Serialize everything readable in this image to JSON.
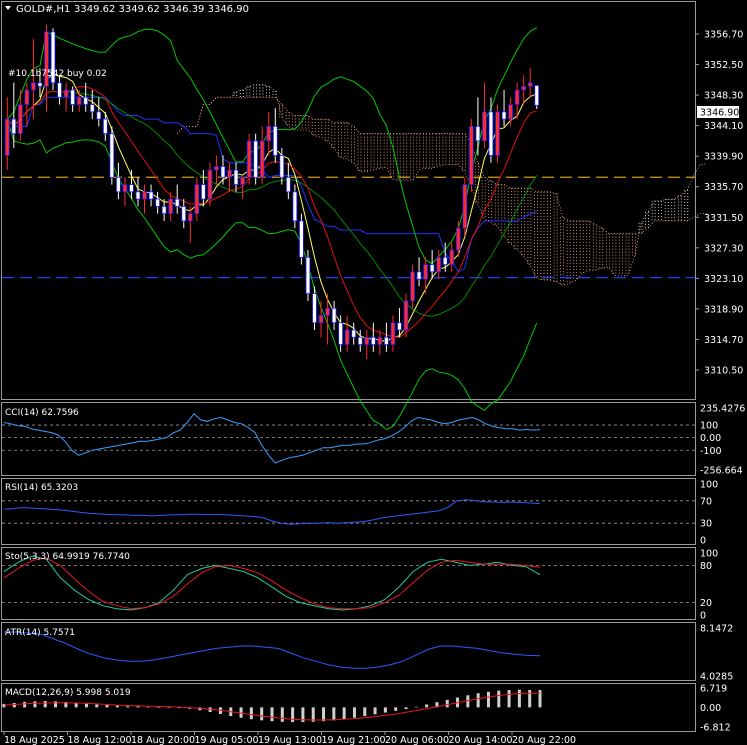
{
  "window": {
    "symbol_label": "GOLD#,H1",
    "ohlc_label": "3349.62 3349.62 3346.39 3346.90",
    "ichimoku_label": "#10.1b7542 buy 0.02",
    "current_price_label": "3346.90"
  },
  "colors": {
    "background": "#000000",
    "bull_body": "#ff2a2a",
    "bear_body": "#ffffff",
    "candle_outline": "#1c1cff",
    "bollinger": "#00c800",
    "ma_fast": "#ffff60",
    "ma_slow": "#e01010",
    "ichimoku_cloud": "#ffffff",
    "ichimoku_cloud_bear": "#ffb090",
    "kijun": "#1e32ff",
    "hline_orange": "#d49a10",
    "hline_blue": "#2040ff",
    "cci_line": "#3aa0ff",
    "rsi_line": "#2a5cff",
    "stoch_main": "#22c8a0",
    "stoch_signal": "#e81818",
    "atr_line": "#2a5cff",
    "macd_hist": "#d0d0d0",
    "macd_signal": "#e81818"
  },
  "chart_data": {
    "type": "candlestick",
    "symbol": "GOLD#",
    "timeframe": "H1",
    "price_axis": {
      "min": 3310.5,
      "max": 3356.7,
      "ticks": [
        "3356.70",
        "3352.50",
        "3348.30",
        "3344.10",
        "3339.90",
        "3335.70",
        "3331.50",
        "3327.30",
        "3323.10",
        "3318.90",
        "3314.70",
        "3310.50"
      ]
    },
    "x_axis_labels": [
      "18 Aug 2025",
      "18 Aug 12:00",
      "18 Aug 20:00",
      "19 Aug 05:00",
      "19 Aug 13:00",
      "19 Aug 21:00",
      "20 Aug 06:00",
      "20 Aug 14:00",
      "20 Aug 22:00"
    ],
    "horizontal_levels": [
      {
        "price": 3337.0,
        "style": "dashed",
        "color": "orange"
      },
      {
        "price": 3323.2,
        "style": "dashed",
        "color": "blue"
      }
    ],
    "candles": [
      {
        "o": 3340,
        "h": 3348,
        "l": 3338,
        "c": 3345
      },
      {
        "o": 3345,
        "h": 3350,
        "l": 3341,
        "c": 3343
      },
      {
        "o": 3343,
        "h": 3349,
        "l": 3342,
        "c": 3347
      },
      {
        "o": 3347,
        "h": 3350,
        "l": 3344,
        "c": 3349
      },
      {
        "o": 3349,
        "h": 3356,
        "l": 3345,
        "c": 3350
      },
      {
        "o": 3350,
        "h": 3352,
        "l": 3348,
        "c": 3349.5
      },
      {
        "o": 3349.5,
        "h": 3358,
        "l": 3346,
        "c": 3357
      },
      {
        "o": 3357,
        "h": 3357.5,
        "l": 3349,
        "c": 3350
      },
      {
        "o": 3350,
        "h": 3351,
        "l": 3347,
        "c": 3348
      },
      {
        "o": 3348,
        "h": 3350,
        "l": 3346,
        "c": 3349
      },
      {
        "o": 3349,
        "h": 3349.5,
        "l": 3346,
        "c": 3347
      },
      {
        "o": 3347,
        "h": 3349,
        "l": 3346,
        "c": 3348
      },
      {
        "o": 3348,
        "h": 3350,
        "l": 3346,
        "c": 3347
      },
      {
        "o": 3347,
        "h": 3349,
        "l": 3345,
        "c": 3346
      },
      {
        "o": 3346,
        "h": 3348,
        "l": 3344,
        "c": 3345
      },
      {
        "o": 3345,
        "h": 3346,
        "l": 3342,
        "c": 3343
      },
      {
        "o": 3343,
        "h": 3344,
        "l": 3336,
        "c": 3337
      },
      {
        "o": 3337,
        "h": 3339,
        "l": 3334,
        "c": 3335
      },
      {
        "o": 3335,
        "h": 3337,
        "l": 3333,
        "c": 3336
      },
      {
        "o": 3336,
        "h": 3338,
        "l": 3334,
        "c": 3335
      },
      {
        "o": 3335,
        "h": 3337,
        "l": 3333,
        "c": 3334
      },
      {
        "o": 3334,
        "h": 3336,
        "l": 3332,
        "c": 3335
      },
      {
        "o": 3335,
        "h": 3336,
        "l": 3333,
        "c": 3334
      },
      {
        "o": 3334,
        "h": 3335,
        "l": 3332,
        "c": 3333
      },
      {
        "o": 3333,
        "h": 3334,
        "l": 3331,
        "c": 3332
      },
      {
        "o": 3332,
        "h": 3335,
        "l": 3331,
        "c": 3334
      },
      {
        "o": 3334,
        "h": 3336,
        "l": 3332,
        "c": 3333
      },
      {
        "o": 3333,
        "h": 3334,
        "l": 3330,
        "c": 3331
      },
      {
        "o": 3331,
        "h": 3333,
        "l": 3328,
        "c": 3332
      },
      {
        "o": 3332,
        "h": 3337,
        "l": 3331,
        "c": 3336
      },
      {
        "o": 3336,
        "h": 3338,
        "l": 3333,
        "c": 3334
      },
      {
        "o": 3334,
        "h": 3339,
        "l": 3333,
        "c": 3338
      },
      {
        "o": 3338,
        "h": 3340,
        "l": 3336,
        "c": 3338.5
      },
      {
        "o": 3338.5,
        "h": 3340,
        "l": 3336,
        "c": 3337
      },
      {
        "o": 3337,
        "h": 3339,
        "l": 3335,
        "c": 3338
      },
      {
        "o": 3338,
        "h": 3339,
        "l": 3335,
        "c": 3336
      },
      {
        "o": 3336,
        "h": 3337,
        "l": 3334,
        "c": 3337
      },
      {
        "o": 3337,
        "h": 3343,
        "l": 3336,
        "c": 3342
      },
      {
        "o": 3342,
        "h": 3343,
        "l": 3336,
        "c": 3337
      },
      {
        "o": 3337,
        "h": 3344,
        "l": 3336,
        "c": 3342
      },
      {
        "o": 3342,
        "h": 3346,
        "l": 3340,
        "c": 3344
      },
      {
        "o": 3344,
        "h": 3346.5,
        "l": 3339,
        "c": 3340
      },
      {
        "o": 3340,
        "h": 3341,
        "l": 3336,
        "c": 3337
      },
      {
        "o": 3337,
        "h": 3339,
        "l": 3334,
        "c": 3335
      },
      {
        "o": 3335,
        "h": 3336,
        "l": 3330,
        "c": 3331
      },
      {
        "o": 3331,
        "h": 3332,
        "l": 3325,
        "c": 3326
      },
      {
        "o": 3326,
        "h": 3327,
        "l": 3320,
        "c": 3321
      },
      {
        "o": 3321,
        "h": 3322,
        "l": 3316,
        "c": 3317
      },
      {
        "o": 3317,
        "h": 3320,
        "l": 3315,
        "c": 3318
      },
      {
        "o": 3318,
        "h": 3321,
        "l": 3314,
        "c": 3319
      },
      {
        "o": 3319,
        "h": 3320,
        "l": 3316,
        "c": 3317
      },
      {
        "o": 3317,
        "h": 3318,
        "l": 3313,
        "c": 3314
      },
      {
        "o": 3314,
        "h": 3318,
        "l": 3313,
        "c": 3316
      },
      {
        "o": 3316,
        "h": 3317,
        "l": 3314,
        "c": 3315
      },
      {
        "o": 3315,
        "h": 3316,
        "l": 3313,
        "c": 3314
      },
      {
        "o": 3314,
        "h": 3316,
        "l": 3312,
        "c": 3315
      },
      {
        "o": 3315,
        "h": 3317,
        "l": 3313,
        "c": 3314
      },
      {
        "o": 3314,
        "h": 3316,
        "l": 3312.5,
        "c": 3315
      },
      {
        "o": 3315,
        "h": 3317,
        "l": 3313,
        "c": 3314
      },
      {
        "o": 3314,
        "h": 3318,
        "l": 3313,
        "c": 3317
      },
      {
        "o": 3317,
        "h": 3319,
        "l": 3315,
        "c": 3316
      },
      {
        "o": 3316,
        "h": 3321,
        "l": 3315,
        "c": 3320
      },
      {
        "o": 3320,
        "h": 3325,
        "l": 3319,
        "c": 3324
      },
      {
        "o": 3324,
        "h": 3326,
        "l": 3322,
        "c": 3323
      },
      {
        "o": 3323,
        "h": 3326,
        "l": 3321,
        "c": 3325
      },
      {
        "o": 3325,
        "h": 3327,
        "l": 3323,
        "c": 3324
      },
      {
        "o": 3324,
        "h": 3327,
        "l": 3323,
        "c": 3326
      },
      {
        "o": 3326,
        "h": 3328,
        "l": 3324,
        "c": 3325
      },
      {
        "o": 3325,
        "h": 3328,
        "l": 3324,
        "c": 3327
      },
      {
        "o": 3327,
        "h": 3331,
        "l": 3326,
        "c": 3330
      },
      {
        "o": 3330,
        "h": 3337,
        "l": 3329,
        "c": 3336
      },
      {
        "o": 3336,
        "h": 3345,
        "l": 3335,
        "c": 3344
      },
      {
        "o": 3344,
        "h": 3348,
        "l": 3340,
        "c": 3342
      },
      {
        "o": 3342,
        "h": 3350,
        "l": 3341,
        "c": 3346
      },
      {
        "o": 3346,
        "h": 3348,
        "l": 3339,
        "c": 3340
      },
      {
        "o": 3340,
        "h": 3347,
        "l": 3339,
        "c": 3346
      },
      {
        "o": 3346,
        "h": 3349,
        "l": 3344,
        "c": 3345
      },
      {
        "o": 3345,
        "h": 3348,
        "l": 3344,
        "c": 3347
      },
      {
        "o": 3347,
        "h": 3350,
        "l": 3345,
        "c": 3349
      },
      {
        "o": 3349,
        "h": 3351,
        "l": 3347,
        "c": 3349.5
      },
      {
        "o": 3349.5,
        "h": 3352,
        "l": 3348,
        "c": 3350
      },
      {
        "o": 3349.62,
        "h": 3349.62,
        "l": 3346.39,
        "c": 3346.9
      }
    ],
    "indicators": {
      "cci": {
        "label": "CCI(14) 62.7596",
        "ticks": [
          "235.4276",
          "100",
          "0.00",
          "-100",
          "-256.664"
        ],
        "range": [
          -256.664,
          235.4276
        ],
        "values": [
          120,
          110,
          95,
          90,
          70,
          60,
          50,
          40,
          20,
          -30,
          -100,
          -140,
          -120,
          -100,
          -90,
          -80,
          -70,
          -60,
          -50,
          -40,
          -30,
          -30,
          -20,
          -10,
          0,
          40,
          60,
          120,
          190,
          140,
          130,
          150,
          160,
          140,
          120,
          110,
          80,
          40,
          -60,
          -140,
          -200,
          -180,
          -160,
          -150,
          -140,
          -120,
          -100,
          -80,
          -80,
          -70,
          -60,
          -60,
          -50,
          -50,
          -40,
          -20,
          -10,
          10,
          40,
          80,
          130,
          160,
          150,
          140,
          120,
          110,
          120,
          140,
          150,
          160,
          140,
          110,
          90,
          80,
          70,
          70,
          60,
          65,
          60,
          63
        ]
      },
      "rsi": {
        "label": "RSI(14) 65.3203",
        "ticks": [
          "100",
          "70",
          "30",
          "0"
        ],
        "range": [
          0,
          100
        ],
        "values": [
          55,
          56,
          58,
          57,
          56,
          55,
          54,
          52,
          50,
          48,
          47,
          46,
          45,
          45,
          44,
          44,
          43,
          44,
          45,
          45,
          46,
          46,
          45,
          46,
          45,
          44,
          43,
          42,
          40,
          34,
          30,
          28,
          29,
          30,
          30,
          31,
          30,
          31,
          32,
          33,
          36,
          40,
          42,
          44,
          46,
          48,
          50,
          52,
          58,
          70,
          72,
          70,
          68,
          68,
          67,
          68,
          67,
          66,
          65
        ]
      },
      "stochastic": {
        "label": "Sto(5,3,3) 64.9919 76.7740",
        "ticks": [
          "100",
          "80",
          "20",
          "0"
        ],
        "range": [
          0,
          100
        ],
        "main": [
          70,
          85,
          95,
          90,
          60,
          40,
          25,
          15,
          10,
          8,
          12,
          20,
          40,
          65,
          75,
          80,
          75,
          70,
          60,
          45,
          30,
          20,
          15,
          10,
          8,
          10,
          15,
          25,
          45,
          70,
          85,
          90,
          85,
          80,
          82,
          85,
          80,
          78,
          65
        ],
        "signal": [
          60,
          75,
          88,
          92,
          80,
          58,
          38,
          22,
          15,
          10,
          12,
          18,
          30,
          50,
          68,
          78,
          80,
          75,
          68,
          55,
          40,
          28,
          18,
          12,
          10,
          10,
          12,
          20,
          32,
          52,
          72,
          85,
          88,
          85,
          82,
          82,
          82,
          80,
          77
        ]
      },
      "atr": {
        "label": "ATR(14) 5.7571",
        "ticks": [
          "8.1472",
          "4.0285"
        ],
        "range": [
          4.0285,
          8.1472
        ],
        "values": [
          7.8,
          7.8,
          7.7,
          7.6,
          7.2,
          6.8,
          6.3,
          5.9,
          5.6,
          5.4,
          5.3,
          5.3,
          5.4,
          5.6,
          5.8,
          6.0,
          6.2,
          6.4,
          6.5,
          6.6,
          6.6,
          6.5,
          6.4,
          6.0,
          5.6,
          5.3,
          5.0,
          4.8,
          4.7,
          4.7,
          4.8,
          5.0,
          5.3,
          5.8,
          6.3,
          6.6,
          6.6,
          6.5,
          6.4,
          6.2,
          6.0,
          5.9,
          5.8,
          5.76
        ]
      },
      "macd": {
        "label": "MACD(12,26,9) 5.998 5.019",
        "ticks": [
          "6.719",
          "0.00",
          "-6.812"
        ],
        "range": [
          -6.812,
          6.719
        ],
        "histogram": [
          1.2,
          1.5,
          1.9,
          2.1,
          2.2,
          2.1,
          1.9,
          1.6,
          1.3,
          1.0,
          0.8,
          0.6,
          0.4,
          0.3,
          0.2,
          0.1,
          0.0,
          -0.2,
          -0.5,
          -1.0,
          -1.6,
          -2.3,
          -3.0,
          -3.6,
          -4.1,
          -4.5,
          -4.8,
          -5.0,
          -5.1,
          -5.1,
          -5.0,
          -4.8,
          -4.5,
          -4.1,
          -3.6,
          -3.0,
          -2.4,
          -1.8,
          -1.2,
          -0.6,
          0.2,
          1.0,
          1.8,
          2.6,
          3.4,
          4.2,
          4.9,
          5.4,
          5.8,
          6.0,
          6.1,
          6.0,
          6.0
        ],
        "signal": [
          0.8,
          1.0,
          1.2,
          1.4,
          1.5,
          1.6,
          1.6,
          1.5,
          1.4,
          1.2,
          1.0,
          0.8,
          0.6,
          0.5,
          0.4,
          0.3,
          0.2,
          0.1,
          -0.1,
          -0.3,
          -0.6,
          -1.0,
          -1.5,
          -2.0,
          -2.5,
          -3.0,
          -3.4,
          -3.8,
          -4.1,
          -4.3,
          -4.4,
          -4.4,
          -4.3,
          -4.1,
          -3.9,
          -3.6,
          -3.2,
          -2.8,
          -2.3,
          -1.7,
          -1.1,
          -0.5,
          0.2,
          0.9,
          1.6,
          2.3,
          3.0,
          3.6,
          4.1,
          4.5,
          4.8,
          4.9,
          5.0
        ]
      }
    }
  }
}
